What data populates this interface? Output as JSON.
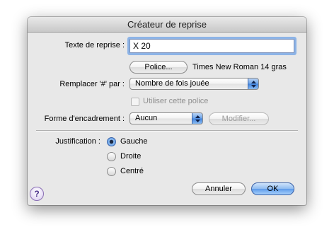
{
  "dialog": {
    "title": "Créateur de reprise"
  },
  "form": {
    "texte_label": "Texte de reprise :",
    "texte_value": "X 20",
    "police_button": "Police...",
    "font_info": "Times New Roman 14 gras",
    "remplacer_label": "Remplacer '#' par :",
    "remplacer_selected": "Nombre de fois jouée",
    "utiliser_checkbox_label": "Utiliser cette police",
    "utiliser_checked": false,
    "forme_label": "Forme d'encadrement :",
    "forme_selected": "Aucun",
    "modifier_button": "Modifier..."
  },
  "justification": {
    "label": "Justification :",
    "options": [
      "Gauche",
      "Droite",
      "Centré"
    ],
    "selected": "Gauche"
  },
  "buttons": {
    "help": "?",
    "cancel": "Annuler",
    "ok": "OK"
  },
  "colors": {
    "accent": "#5d9bea",
    "focus_ring": "#8cb3e6",
    "window_bg": "#e8e8e8"
  },
  "icons": {
    "popup_arrows": "updown-arrows-icon",
    "help": "help-icon"
  }
}
